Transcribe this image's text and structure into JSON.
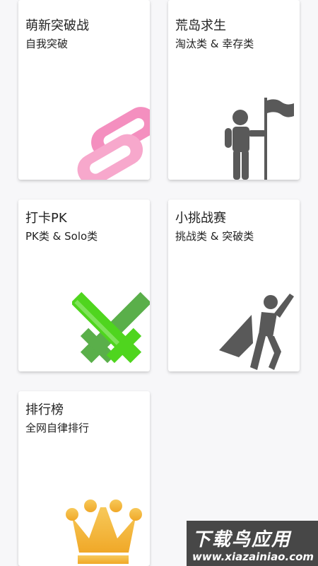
{
  "cards": [
    {
      "title": "萌新突破战",
      "subtitle": "自我突破",
      "icon": "chain-link-icon"
    },
    {
      "title": "荒岛求生",
      "subtitle": "淘汰类 & 幸存类",
      "icon": "person-with-flag-icon"
    },
    {
      "title": "打卡PK",
      "subtitle": "PK类 & Solo类",
      "icon": "crossed-swords-icon"
    },
    {
      "title": "小挑战赛",
      "subtitle": "挑战类 & 突破类",
      "icon": "superhero-icon"
    },
    {
      "title": "排行榜",
      "subtitle": "全网自律排行",
      "icon": "crown-icon"
    }
  ],
  "watermark": {
    "text": "下载鸟应用",
    "url": "www.xiazainiao.com"
  },
  "colors": {
    "background": "#f7f7f9",
    "card": "#ffffff",
    "chain_pink": "#f48fbf",
    "chain_light_pink": "#f7a8cc",
    "sword_green": "#5aaf4a",
    "sword_bright_green": "#4fd51e",
    "figure_gray": "#595959",
    "crown_gold": "#f4b63a"
  }
}
